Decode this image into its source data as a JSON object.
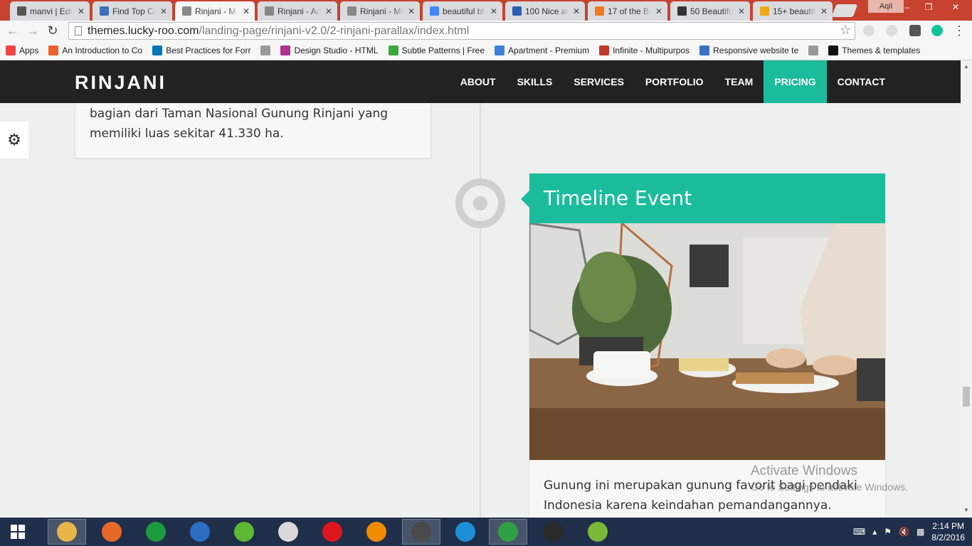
{
  "browser": {
    "tabs": [
      {
        "title": "manvi | Edu",
        "favicon": "hash-icon",
        "color": "#555555",
        "active": false
      },
      {
        "title": "Find Top Co",
        "favicon": "bird-icon",
        "color": "#3b6fb6",
        "active": false
      },
      {
        "title": "Rinjani - M",
        "favicon": "page-icon",
        "color": "#888888",
        "active": true
      },
      {
        "title": "Rinjani - Ad",
        "favicon": "page-icon",
        "color": "#888888",
        "active": false
      },
      {
        "title": "Rinjani - Mi",
        "favicon": "page-icon",
        "color": "#888888",
        "active": false
      },
      {
        "title": "beautiful bl",
        "favicon": "google-icon",
        "color": "#4285f4",
        "active": false
      },
      {
        "title": "100 Nice an",
        "favicon": "h-icon",
        "color": "#2a5db0",
        "active": false
      },
      {
        "title": "17 of the Be",
        "favicon": "hubspot-icon",
        "color": "#f57722",
        "active": false
      },
      {
        "title": "50 Beautiful",
        "favicon": "s-icon",
        "color": "#333333",
        "active": false
      },
      {
        "title": "15+ beautif",
        "favicon": "w-icon",
        "color": "#f0a818",
        "active": false
      }
    ],
    "user": "Aqil",
    "url_host": "themes.lucky-roo.com",
    "url_path": "/landing-page/rinjani-v2.0/2-rinjani-parallax/index.html",
    "bookmarks": [
      {
        "label": "Apps",
        "icon": "apps-grid-icon",
        "color": "#e44"
      },
      {
        "label": "An Introduction to Co",
        "icon": "plus-icon",
        "color": "#e9622b"
      },
      {
        "label": "Best Practices for Forr",
        "icon": "linkedin-icon",
        "color": "#0077b5"
      },
      {
        "label": "",
        "icon": "page-icon",
        "color": "#999999"
      },
      {
        "label": "Design Studio - HTML",
        "icon": "d-icon",
        "color": "#b0308a"
      },
      {
        "label": "Subtle Patterns | Free",
        "icon": "pattern-icon",
        "color": "#3aa83a"
      },
      {
        "label": "Apartment - Premium",
        "icon": "house-icon",
        "color": "#3b82d6"
      },
      {
        "label": "Infinite - Multipurpos",
        "icon": "wp-icon",
        "color": "#c0392b"
      },
      {
        "label": "Responsive website te",
        "icon": "shield-icon",
        "color": "#3a6fc4"
      },
      {
        "label": "",
        "icon": "page-icon",
        "color": "#999999"
      },
      {
        "label": "Themes & templates",
        "icon": "w-icon",
        "color": "#111111"
      }
    ]
  },
  "site": {
    "brand": "RINJANI",
    "menu": [
      "ABOUT",
      "SKILLS",
      "SERVICES",
      "PORTFOLIO",
      "TEAM",
      "PRICING",
      "CONTACT"
    ],
    "active_menu": "PRICING",
    "accent": "#1abc9c",
    "left_card_text": "bagian dari Taman Nasional Gunung Rinjani yang memiliki luas sekitar 41.330 ha.",
    "event_title": "Timeline Event",
    "event_text": "Gunung ini merupakan gunung favorit bagi pendaki Indonesia karena keindahan pemandangannya. Gunung ini"
  },
  "watermark": {
    "title": "Activate Windows",
    "subtitle": "Go to Settings to activate Windows."
  },
  "taskbar": {
    "apps": [
      "file-explorer-icon",
      "firefox-icon",
      "store-icon",
      "outlook-icon",
      "green-app-icon",
      "scissors-icon",
      "opera-icon",
      "vlc-icon",
      "sublime-icon",
      "ie-icon",
      "chrome-icon",
      "terminal-icon",
      "bluestacks-icon"
    ],
    "time": "2:14 PM",
    "date": "8/2/2016"
  }
}
